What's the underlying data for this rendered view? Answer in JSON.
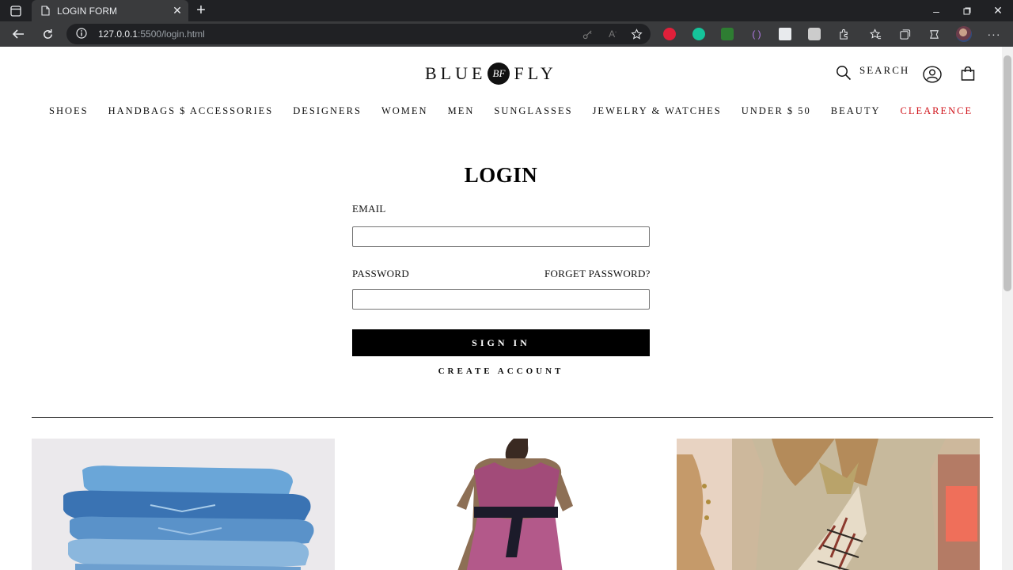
{
  "browser": {
    "tab_title": "LOGIN FORM",
    "url_host": "127.0.0.1",
    "url_rest": ":5500/login.html",
    "extensions": [
      {
        "name": "adblock-plus-icon",
        "color": "#e0203a",
        "label": "ABP"
      },
      {
        "name": "grammarly-icon",
        "color": "#15c39a",
        "label": "G"
      },
      {
        "name": "color-picker-icon",
        "color": "#2e7d32",
        "label": ""
      },
      {
        "name": "brackets-icon",
        "color": "#7b3fbf",
        "label": "( )"
      },
      {
        "name": "screen-capture-icon",
        "color": "#e8eaed",
        "label": ""
      },
      {
        "name": "camera-icon",
        "color": "#cccccc",
        "label": ""
      }
    ]
  },
  "header": {
    "logo_left": "BLUE",
    "logo_mark": "BF",
    "logo_right": "FLY",
    "search_label": "SEARCH"
  },
  "nav": {
    "items": [
      "SHOES",
      "HANDBAGS $ ACCESSORIES",
      "DESIGNERS",
      "WOMEN",
      "MEN",
      "SUNGLASSES",
      "JEWELRY & WATCHES",
      "UNDER $ 50",
      "BEAUTY",
      "CLEARENCE"
    ],
    "highlight_color": "#d0141b"
  },
  "login": {
    "title": "LOGIN",
    "email_label": "EMAIL",
    "email_value": "",
    "password_label": "PASSWORD",
    "password_value": "",
    "forgot_label": "FORGET PASSWORD?",
    "signin_label": "SIGN IN",
    "create_label": "CREATE ACCOUNT"
  },
  "promos": [
    {
      "name": "promo-denim-image",
      "subject": "stack of folded jeans"
    },
    {
      "name": "promo-dress-image",
      "subject": "woman in pink dress"
    },
    {
      "name": "promo-street-style-image",
      "subject": "woman with checked belt bag"
    }
  ]
}
